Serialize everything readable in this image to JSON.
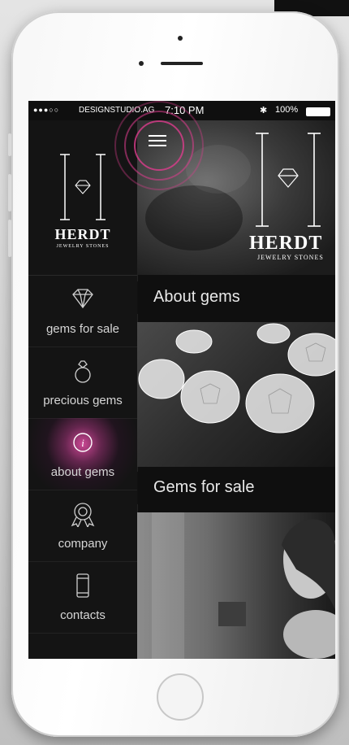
{
  "status_bar": {
    "signal": "●●●○○",
    "carrier": "DESIGNSTUDIO.AG",
    "time": "7:10 PM",
    "bluetooth": "✱",
    "battery": "100%"
  },
  "menu_icon": "hamburger-icon",
  "brand": {
    "name": "HERDT",
    "tagline": "JEWELRY STONES"
  },
  "sidebar": {
    "items": [
      {
        "label": "gems for sale",
        "icon": "diamond-icon",
        "active": false
      },
      {
        "label": "precious gems",
        "icon": "ring-icon",
        "active": false
      },
      {
        "label": "about gems",
        "icon": "info-icon",
        "active": true
      },
      {
        "label": "company",
        "icon": "award-ribbon-icon",
        "active": false
      },
      {
        "label": "contacts",
        "icon": "phone-icon",
        "active": false
      }
    ]
  },
  "sections": [
    {
      "title": "About gems"
    },
    {
      "title": "Gems for sale"
    }
  ],
  "colors": {
    "accent": "#e0529c",
    "background": "#0f0f0f",
    "text": "#d6d6d6"
  }
}
